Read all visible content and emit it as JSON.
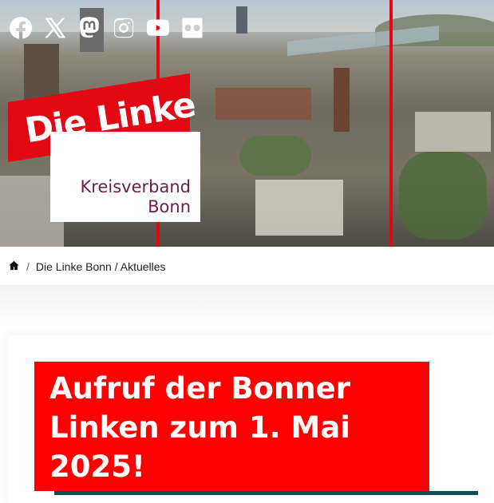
{
  "social": [
    {
      "name": "facebook-icon"
    },
    {
      "name": "x-icon"
    },
    {
      "name": "mastodon-icon"
    },
    {
      "name": "instagram-icon"
    },
    {
      "name": "youtube-icon"
    },
    {
      "name": "flickr-icon"
    }
  ],
  "logo": {
    "party": "Die Linke",
    "subtitle_line1": "Kreisverband",
    "subtitle_line2": "Bonn"
  },
  "breadcrumb": {
    "home_icon": "home-icon",
    "separator": "/",
    "text": "Die Linke Bonn / Aktuelles"
  },
  "article": {
    "title": "Aufruf der Bonner Linken zum 1. Mai 2025!"
  },
  "colors": {
    "brand_red": "#e30613",
    "title_red": "#ff0000",
    "plum": "#6b1f4a",
    "teal": "#0e4e56"
  }
}
